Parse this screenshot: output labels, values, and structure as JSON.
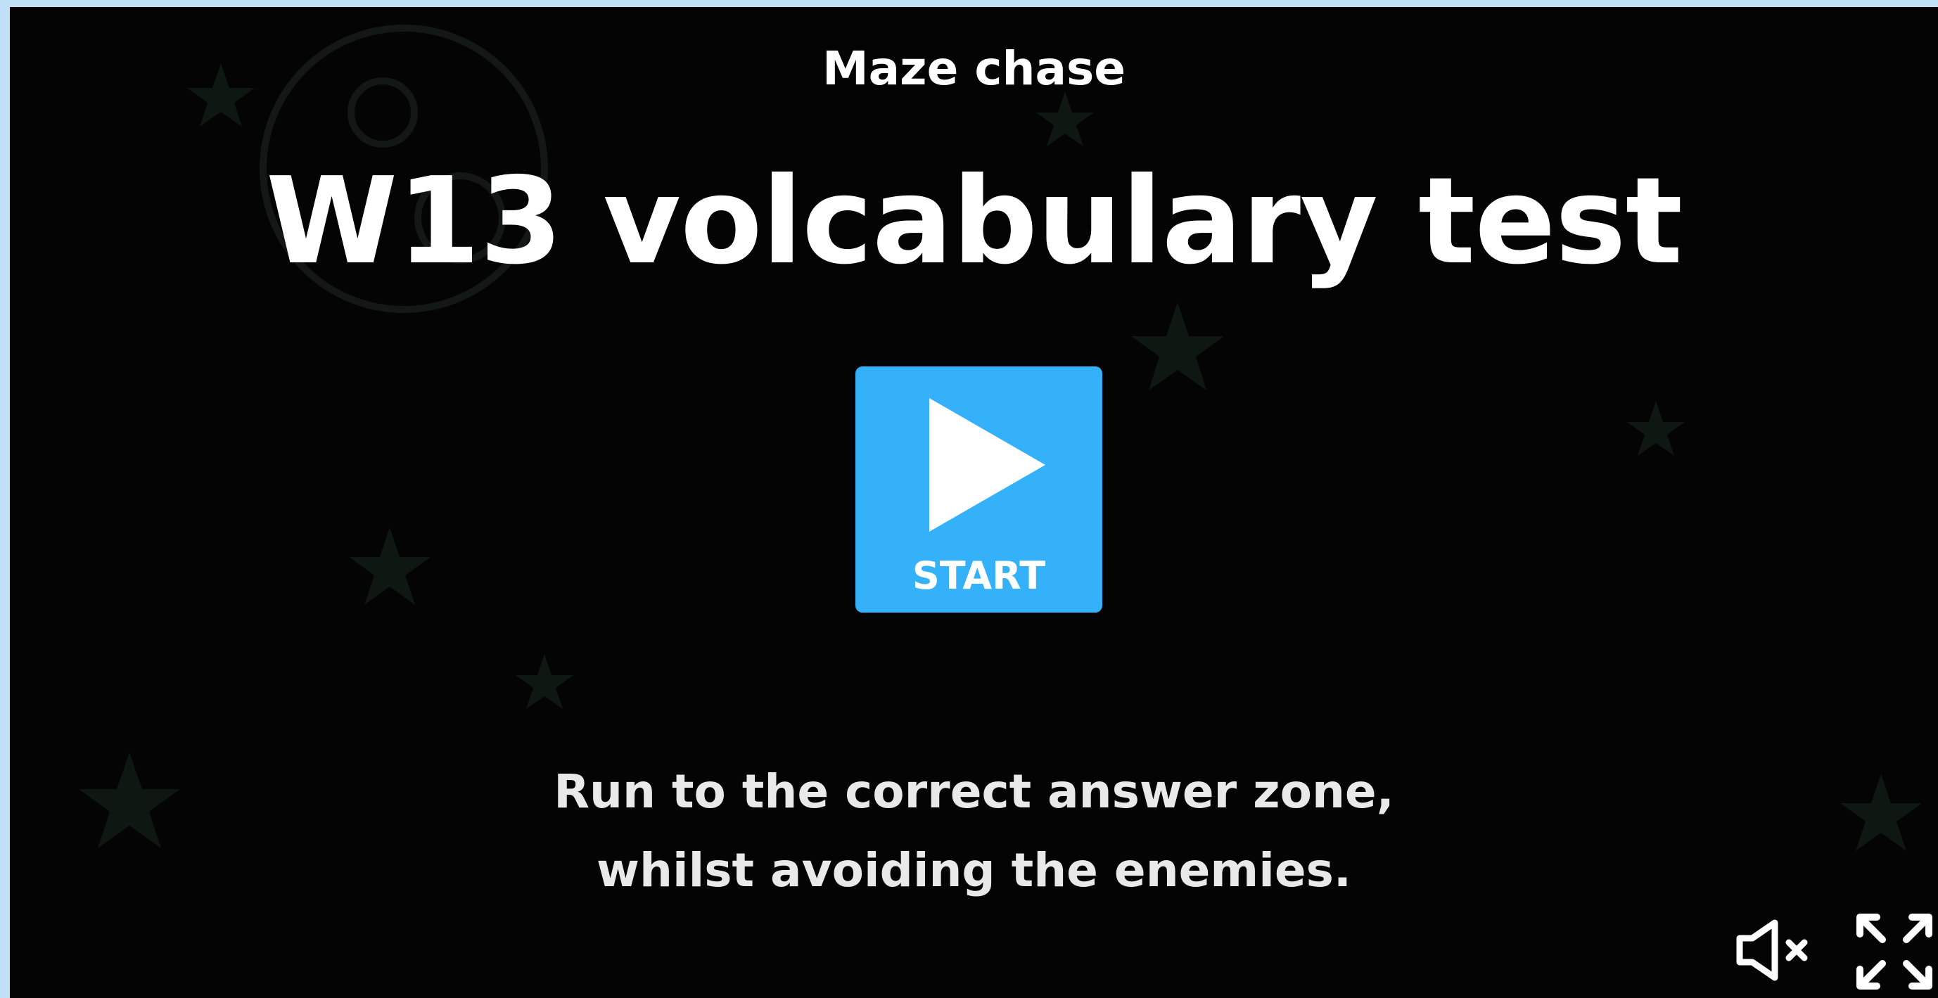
{
  "activity": {
    "template_name": "Maze chase",
    "title": "W13 volcabulary test",
    "start_label": "START",
    "instructions": [
      "Run to the correct answer zone,",
      "whilst avoiding the enemies."
    ]
  },
  "controls": {
    "mute_icon": "speaker-muted-icon",
    "fullscreen_icon": "fullscreen-icon"
  },
  "colors": {
    "frame": "#bfe0f6",
    "background": "#040404",
    "start_button": "#35b1fa",
    "text": "#ffffff"
  }
}
